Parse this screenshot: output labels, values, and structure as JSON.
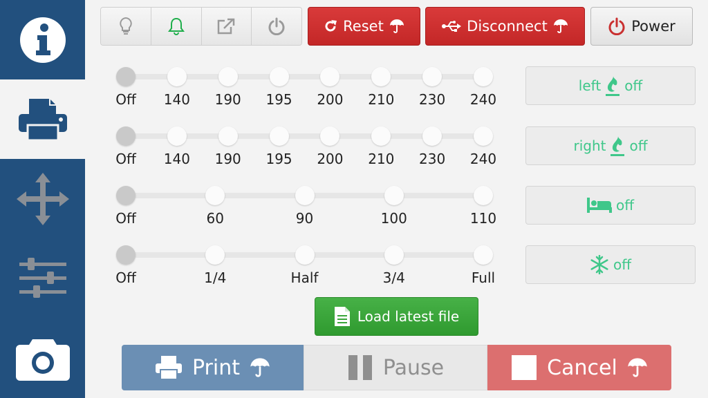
{
  "sidebar": {
    "items": [
      {
        "icon": "info-icon",
        "active": false
      },
      {
        "icon": "printer-icon",
        "active": true
      },
      {
        "icon": "move-icon",
        "active": false
      },
      {
        "icon": "sliders-icon",
        "active": false
      },
      {
        "icon": "camera-icon",
        "active": false
      }
    ]
  },
  "toolbar": {
    "icons": [
      "lightbulb-icon",
      "bell-icon",
      "external-link-icon",
      "power-icon"
    ],
    "reset_label": "Reset",
    "disconnect_label": "Disconnect",
    "power_label": "Power",
    "colors": {
      "danger": "#c93030",
      "success": "#1fae4b"
    }
  },
  "sliders": [
    {
      "name": "left-extruder-temp",
      "labels": [
        "Off",
        "140",
        "190",
        "195",
        "200",
        "210",
        "230",
        "240"
      ],
      "selected_index": 0
    },
    {
      "name": "right-extruder-temp",
      "labels": [
        "Off",
        "140",
        "190",
        "195",
        "200",
        "210",
        "230",
        "240"
      ],
      "selected_index": 0
    },
    {
      "name": "bed-temp",
      "labels": [
        "Off",
        "60",
        "90",
        "100",
        "110"
      ],
      "selected_index": 0
    },
    {
      "name": "fan-speed",
      "labels": [
        "Off",
        "1/4",
        "Half",
        "3/4",
        "Full"
      ],
      "selected_index": 0
    }
  ],
  "toggles": {
    "left": {
      "prefix": "left",
      "suffix": "off",
      "icon": "flame-icon"
    },
    "right": {
      "prefix": "right",
      "suffix": "off",
      "icon": "flame-icon"
    },
    "bed": {
      "suffix": "off",
      "icon": "bed-icon"
    },
    "fan": {
      "suffix": "off",
      "icon": "snowflake-icon"
    },
    "color": "#3fc78a"
  },
  "load_file": {
    "label": "Load latest file",
    "icon": "file-icon"
  },
  "actions": {
    "print_label": "Print",
    "pause_label": "Pause",
    "cancel_label": "Cancel"
  }
}
